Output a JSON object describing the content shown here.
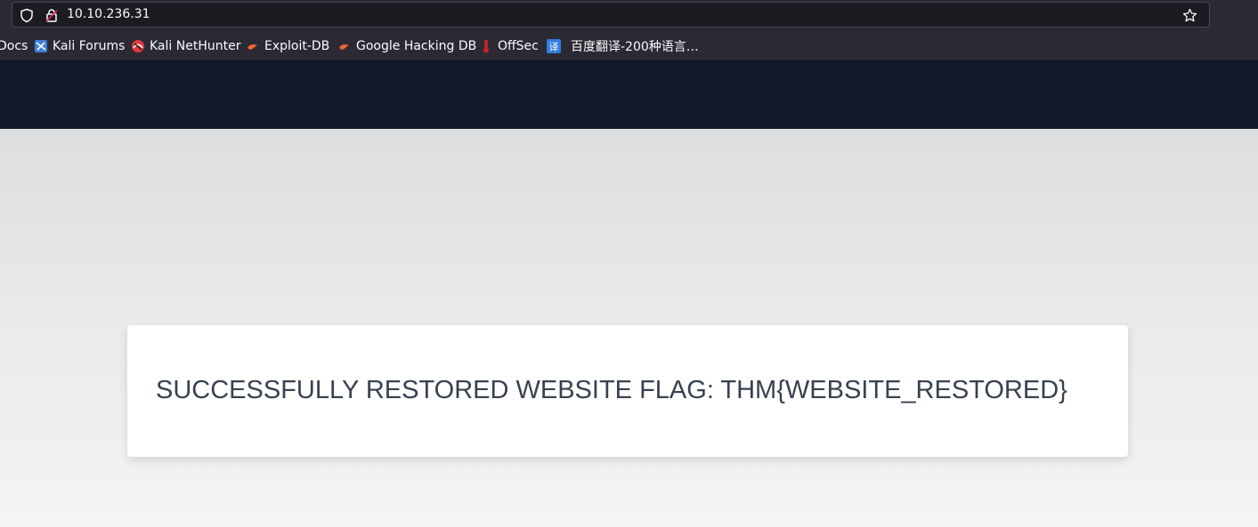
{
  "browser": {
    "url": "10.10.236.31",
    "bookmarks": [
      {
        "label": "Docs",
        "icon": "kali-docs-icon"
      },
      {
        "label": "Kali Forums",
        "icon": "kali-forums-icon"
      },
      {
        "label": "Kali NetHunter",
        "icon": "kali-nethunter-icon"
      },
      {
        "label": "Exploit-DB",
        "icon": "exploit-db-icon"
      },
      {
        "label": "Google Hacking DB",
        "icon": "google-hacking-db-icon"
      },
      {
        "label": "OffSec",
        "icon": "offsec-icon"
      },
      {
        "label": "百度翻译-200种语言…",
        "icon": "baidu-translate-icon"
      }
    ]
  },
  "page": {
    "flag_message": "SUCCESSFULLY RESTORED WEBSITE FLAG: THM{WEBSITE_RESTORED}"
  },
  "colors": {
    "header_bg": "#111827",
    "card_bg": "#ffffff",
    "text": "#374151"
  }
}
